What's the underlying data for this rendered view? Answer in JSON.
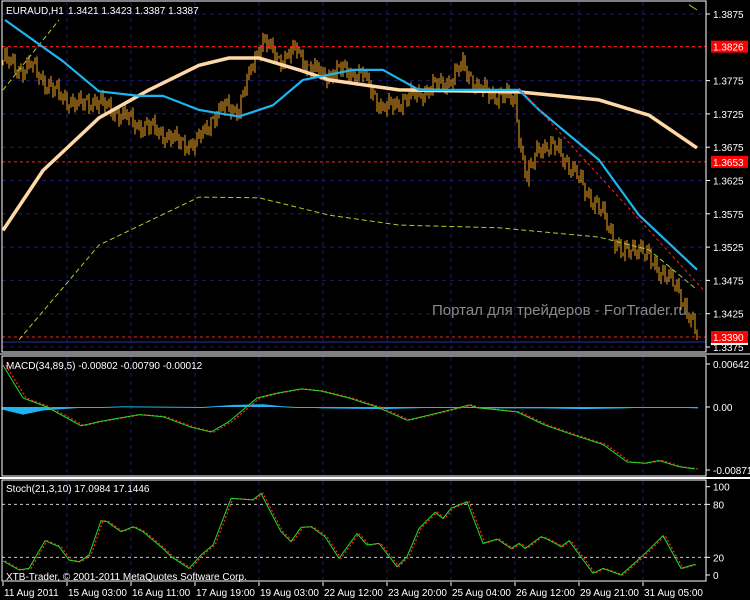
{
  "colors": {
    "background": "#000000",
    "bars": "#f5a623",
    "grid": "#1c1c6e",
    "fast_ma": "#1eb4f0",
    "slow_ma": "#ffd8a8",
    "long_ma": "#a8d030",
    "trend": "#ff2020",
    "level_box": "#ff0000",
    "macd_line": "#20e020",
    "macd_signal": "#ff2020",
    "macd_hist": "#1eb4f0",
    "stoch_main": "#20e020",
    "stoch_signal": "#ff2020"
  },
  "header": {
    "symbol": "EURAUD,H1",
    "ohlc": "1.3421 1.3423 1.3387 1.3387"
  },
  "watermark": "Портал для трейдеров - ForTrader.ru",
  "copyright": "XTB-Trader, © 2001-2011 MetaQuotes Software Corp.",
  "chart_data": [
    {
      "type": "candlestick-bars",
      "title": "EURAUD,H1",
      "ylim": [
        1.3375,
        1.3875
      ],
      "price_ticks": [
        "1.3875",
        "1.3775",
        "1.3725",
        "1.3675",
        "1.3625",
        "1.3575",
        "1.3525",
        "1.3475",
        "1.3425",
        "1.3375"
      ],
      "level_labels": [
        "1.3826",
        "1.3653",
        "1.3390"
      ],
      "levels": [
        1.3826,
        1.3653,
        1.339
      ],
      "close_keypoints": [
        [
          1,
          1.3806
        ],
        [
          8,
          1.3791
        ],
        [
          14,
          1.3798
        ],
        [
          20,
          1.3776
        ],
        [
          28,
          1.3753
        ],
        [
          38,
          1.3738
        ],
        [
          45,
          1.3746
        ],
        [
          55,
          1.3731
        ],
        [
          68,
          1.3708
        ],
        [
          77,
          1.3701
        ],
        [
          85,
          1.3686
        ],
        [
          96,
          1.3678
        ],
        [
          104,
          1.3716
        ],
        [
          112,
          1.3738
        ],
        [
          118,
          1.3731
        ],
        [
          126,
          1.3813
        ],
        [
          130,
          1.3836
        ],
        [
          138,
          1.3806
        ],
        [
          147,
          1.3821
        ],
        [
          152,
          1.3798
        ],
        [
          160,
          1.3783
        ],
        [
          170,
          1.3791
        ],
        [
          180,
          1.3783
        ],
        [
          190,
          1.3731
        ],
        [
          200,
          1.3746
        ],
        [
          212,
          1.3761
        ],
        [
          224,
          1.3776
        ],
        [
          230,
          1.3798
        ],
        [
          238,
          1.3761
        ],
        [
          248,
          1.3753
        ],
        [
          256,
          1.3746
        ],
        [
          259,
          1.3671
        ],
        [
          262,
          1.3626
        ],
        [
          268,
          1.3678
        ],
        [
          278,
          1.3671
        ],
        [
          288,
          1.3626
        ],
        [
          300,
          1.3573
        ],
        [
          310,
          1.3513
        ],
        [
          318,
          1.3528
        ],
        [
          325,
          1.3498
        ],
        [
          332,
          1.3483
        ],
        [
          340,
          1.3446
        ],
        [
          347,
          1.3393
        ]
      ],
      "series": [
        {
          "name": "fast MA",
          "points": [
            [
              1,
              1.3866
            ],
            [
              30,
              1.3804
            ],
            [
              48,
              1.3759
            ],
            [
              68,
              1.3752
            ],
            [
              80,
              1.3752
            ],
            [
              98,
              1.3731
            ],
            [
              118,
              1.3721
            ],
            [
              135,
              1.3738
            ],
            [
              150,
              1.3776
            ],
            [
              175,
              1.3791
            ],
            [
              190,
              1.3791
            ],
            [
              208,
              1.3761
            ],
            [
              258,
              1.3761
            ],
            [
              268,
              1.3731
            ],
            [
              298,
              1.3656
            ],
            [
              318,
              1.3573
            ],
            [
              347,
              1.3491
            ]
          ]
        },
        {
          "name": "slow MA",
          "points": [
            [
              0,
              1.355
            ],
            [
              20,
              1.364
            ],
            [
              48,
              1.3719
            ],
            [
              73,
              1.3761
            ],
            [
              98,
              1.3798
            ],
            [
              113,
              1.3809
            ],
            [
              128,
              1.3809
            ],
            [
              148,
              1.3791
            ],
            [
              163,
              1.3776
            ],
            [
              198,
              1.3761
            ],
            [
              258,
              1.3758
            ],
            [
              298,
              1.3746
            ],
            [
              323,
              1.3723
            ],
            [
              347,
              1.3674
            ]
          ]
        },
        {
          "name": "long MA",
          "points": [
            [
              8,
              1.3386
            ],
            [
              48,
              1.3528
            ],
            [
              98,
              1.36
            ],
            [
              128,
              1.3599
            ],
            [
              163,
              1.3573
            ],
            [
              198,
              1.3558
            ],
            [
              248,
              1.3554
            ],
            [
              298,
              1.354
            ],
            [
              323,
              1.3521
            ],
            [
              347,
              1.3461
            ]
          ]
        },
        {
          "name": "long MA (prior)",
          "points": [
            [
              0,
              1.3761
            ],
            [
              28,
              1.3866
            ]
          ]
        },
        {
          "name": "long MA (edge)",
          "points": [
            [
              343,
              1.3889
            ],
            [
              347,
              1.3881
            ]
          ]
        },
        {
          "name": "trendline",
          "points": [
            [
              258,
              1.3764
            ],
            [
              351,
              1.3458
            ]
          ]
        }
      ]
    },
    {
      "type": "line",
      "title": "MACD(34,89,5) -0.00802 -0.00790 -0.00012",
      "ylim": [
        -0.00871,
        0.00642
      ],
      "tick_labels": [
        "0.00642",
        "0.00",
        "-0.00871"
      ],
      "macd": [
        [
          0,
          0.006
        ],
        [
          10,
          0.0013
        ],
        [
          22,
          0.0
        ],
        [
          39,
          -0.0027
        ],
        [
          48,
          -0.0021
        ],
        [
          68,
          -0.0011
        ],
        [
          80,
          -0.0014
        ],
        [
          94,
          -0.0029
        ],
        [
          104,
          -0.0036
        ],
        [
          113,
          -0.0021
        ],
        [
          127,
          0.0013
        ],
        [
          137,
          0.002
        ],
        [
          149,
          0.0026
        ],
        [
          159,
          0.0023
        ],
        [
          173,
          0.0013
        ],
        [
          187,
          0.0
        ],
        [
          202,
          -0.0019
        ],
        [
          214,
          -0.0011
        ],
        [
          228,
          -0.0001
        ],
        [
          233,
          0.0003
        ],
        [
          237,
          -0.0001
        ],
        [
          257,
          -0.0007
        ],
        [
          271,
          -0.0026
        ],
        [
          285,
          -0.004
        ],
        [
          300,
          -0.0054
        ],
        [
          312,
          -0.0079
        ],
        [
          321,
          -0.0081
        ],
        [
          328,
          -0.0077
        ],
        [
          338,
          -0.0086
        ],
        [
          346,
          -0.0089
        ]
      ],
      "histogram": [
        [
          0,
          -0.0004
        ],
        [
          10,
          -0.0011
        ],
        [
          20,
          -0.0005
        ],
        [
          40,
          -0.0001
        ],
        [
          60,
          0.0001
        ],
        [
          100,
          0.0
        ],
        [
          115,
          0.0003
        ],
        [
          130,
          0.0004
        ],
        [
          140,
          0.0001
        ],
        [
          160,
          -0.0002
        ],
        [
          190,
          -0.0003
        ],
        [
          230,
          0.0
        ],
        [
          240,
          -0.0002
        ],
        [
          270,
          -0.0002
        ],
        [
          290,
          -0.0003
        ],
        [
          310,
          -0.0002
        ],
        [
          330,
          0.0
        ],
        [
          347,
          -0.0002
        ]
      ]
    },
    {
      "type": "line",
      "title": "Stoch(21,3,10) 17.0984 17.1446",
      "ylim": [
        0,
        100
      ],
      "tick_labels": [
        "100",
        "80",
        "20",
        "0"
      ],
      "levels": [
        80,
        20
      ],
      "main": [
        [
          0,
          15.8
        ],
        [
          8,
          5.7
        ],
        [
          13,
          7.5
        ],
        [
          21,
          38.9
        ],
        [
          28,
          32
        ],
        [
          33,
          17
        ],
        [
          38,
          15
        ],
        [
          43,
          22.6
        ],
        [
          49,
          61.5
        ],
        [
          52,
          60.4
        ],
        [
          59,
          49
        ],
        [
          65,
          54.7
        ],
        [
          70,
          49
        ],
        [
          80,
          30
        ],
        [
          84,
          20.8
        ],
        [
          93,
          7.5
        ],
        [
          99,
          22.6
        ],
        [
          105,
          34
        ],
        [
          114,
          86.8
        ],
        [
          125,
          85
        ],
        [
          129,
          92.5
        ],
        [
          132,
          79
        ],
        [
          139,
          49
        ],
        [
          144,
          37.7
        ],
        [
          149,
          54
        ],
        [
          154,
          54.7
        ],
        [
          161,
          43.4
        ],
        [
          168,
          18.9
        ],
        [
          177,
          47
        ],
        [
          182,
          34
        ],
        [
          188,
          35.8
        ],
        [
          197,
          9.4
        ],
        [
          202,
          20.8
        ],
        [
          208,
          52.8
        ],
        [
          216,
          71
        ],
        [
          220,
          64
        ],
        [
          224,
          75.5
        ],
        [
          232,
          83
        ],
        [
          240,
          35.8
        ],
        [
          247,
          40.8
        ],
        [
          254,
          30
        ],
        [
          258,
          35.8
        ],
        [
          261,
          30
        ],
        [
          269,
          43.4
        ],
        [
          273,
          39.6
        ],
        [
          279,
          32
        ],
        [
          283,
          38.9
        ],
        [
          295,
          1.9
        ],
        [
          300,
          7.5
        ],
        [
          309,
          0
        ],
        [
          319,
          20
        ],
        [
          330,
          44.5
        ],
        [
          339,
          7.5
        ],
        [
          346,
          12
        ]
      ]
    }
  ],
  "time_axis": [
    "11 Aug 2011",
    "15 Aug 03:00",
    "16 Aug 11:00",
    "17 Aug 19:00",
    "19 Aug 03:00",
    "22 Aug 12:00",
    "23 Aug 20:00",
    "25 Aug 04:00",
    "26 Aug 12:00",
    "29 Aug 21:00",
    "31 Aug 05:00"
  ]
}
